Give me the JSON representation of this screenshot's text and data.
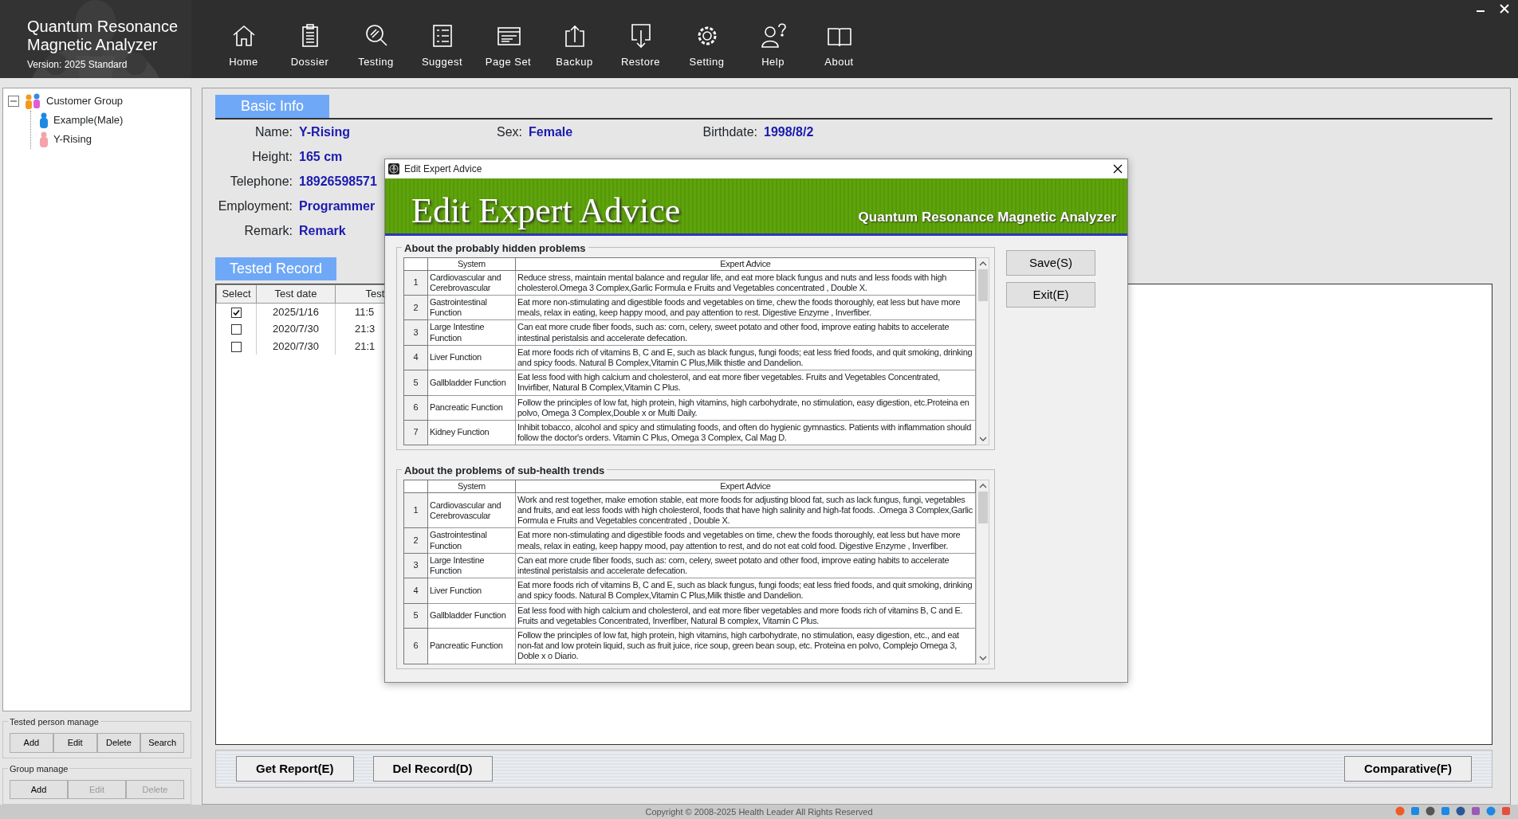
{
  "app": {
    "title_lines": [
      "Quantum Resonance",
      "Magnetic Analyzer"
    ],
    "version": "Version: 2025 Standard"
  },
  "toolbar": [
    {
      "label": "Home",
      "kind": "home"
    },
    {
      "label": "Dossier",
      "kind": "dossier"
    },
    {
      "label": "Testing",
      "kind": "testing"
    },
    {
      "label": "Suggest",
      "kind": "suggest"
    },
    {
      "label": "Page Set",
      "kind": "page"
    },
    {
      "label": "Backup",
      "kind": "backup"
    },
    {
      "label": "Restore",
      "kind": "restore"
    },
    {
      "label": "Setting",
      "kind": "setting"
    },
    {
      "label": "Help",
      "kind": "help"
    },
    {
      "label": "About",
      "kind": "about"
    }
  ],
  "tree": {
    "label": "Customer Group",
    "expanded": true,
    "children": [
      {
        "label": "Example(Male)",
        "color": "#1e88e5"
      },
      {
        "label": "Y-Rising",
        "color": "#f4a3aa"
      }
    ]
  },
  "tested_person_manage": {
    "title": "Tested person manage",
    "buttons": [
      {
        "label": "Add",
        "disabled": false
      },
      {
        "label": "Edit",
        "disabled": false
      },
      {
        "label": "Delete",
        "disabled": false
      },
      {
        "label": "Search",
        "disabled": false
      }
    ]
  },
  "group_manage": {
    "title": "Group manage",
    "buttons": [
      {
        "label": "Add",
        "disabled": false
      },
      {
        "label": "Edit",
        "disabled": true
      },
      {
        "label": "Delete",
        "disabled": true
      }
    ]
  },
  "basic_info": {
    "title": "Basic Info",
    "rows": [
      [
        {
          "label": "Name:",
          "value": "Y-Rising"
        },
        {
          "label": "Sex:",
          "value": "Female"
        },
        {
          "label": "Birthdate:",
          "value": "1998/8/2"
        }
      ],
      [
        {
          "label": "Height:",
          "value": "165 cm"
        }
      ],
      [
        {
          "label": "Telephone:",
          "value": "18926598571"
        }
      ],
      [
        {
          "label": "Employment:",
          "value": "Programmer"
        }
      ],
      [
        {
          "label": "Remark:",
          "value": "Remark"
        }
      ]
    ]
  },
  "tested_record": {
    "title": "Tested Record",
    "columns": [
      "Select",
      "Test date",
      "Test"
    ],
    "rows": [
      {
        "checked": true,
        "date": "2025/1/16",
        "time": "11:5"
      },
      {
        "checked": false,
        "date": "2020/7/30",
        "time": "21:3"
      },
      {
        "checked": false,
        "date": "2020/7/30",
        "time": "21:1"
      }
    ]
  },
  "left_buttons": [
    "Get Report(E)",
    "Del Record(D)"
  ],
  "right_buttons": [
    "Comparative(F)"
  ],
  "footer": "Copyright © 2008-2025 Health Leader All Rights Reserved",
  "dialog": {
    "title": "Edit Expert Advice",
    "banner_title": "Edit Expert Advice",
    "banner_subtitle": "Quantum Resonance Magnetic Analyzer",
    "buttons": [
      "Save(S)",
      "Exit(E)"
    ],
    "sections": [
      {
        "title": "About the probably hidden problems",
        "columns": [
          "System",
          "Expert Advice"
        ],
        "rows": [
          {
            "index": "1",
            "system": "Cardiovascular and Cerebrovascular",
            "advice": "Reduce stress, maintain mental balance and regular life, and eat more black fungus and nuts and less foods with high cholesterol.Omega 3 Complex,Garlic Formula e Fruits and Vegetables concentrated , Double X."
          },
          {
            "index": "2",
            "system": "Gastrointestinal Function",
            "advice": "Eat more non-stimulating and digestible foods and vegetables on time, chew the foods thoroughly, eat less but have more meals, relax in eating, keep happy mood, and pay attention to rest. Digestive Enzyme , Inverfiber."
          },
          {
            "index": "3",
            "system": "Large Intestine Function",
            "advice": "Can eat more crude fiber foods, such as: corn, celery, sweet potato and other food, improve eating habits to accelerate intestinal peristalsis and accelerate defecation."
          },
          {
            "index": "4",
            "system": "Liver Function",
            "advice": "Eat more foods rich of vitamins B, C and E, such as black fungus, fungi foods; eat less fried foods, and quit smoking, drinking and spicy foods. Natural B Complex,Vitamin C Plus,Milk thistle and Dandelion."
          },
          {
            "index": "5",
            "system": "Gallbladder Function",
            "advice": "Eat less food with high calcium and cholesterol, and eat more fiber vegetables. Fruits and Vegetables Concentrated, Invirfiber, Natural B Complex,Vitamin C Plus."
          },
          {
            "index": "6",
            "system": "Pancreatic Function",
            "advice": "Follow the principles of low fat, high protein, high vitamins, high carbohydrate, no stimulation, easy digestion, etc.Proteina en polvo, Omega 3 Complex,Double x or  Multi Daily."
          },
          {
            "index": "7",
            "system": "Kidney Function",
            "advice": "Inhibit tobacco, alcohol and spicy and stimulating foods, and often do hygienic gymnastics. Patients with inflammation should follow the doctor's orders. Vitamin C Plus, Omega 3 Complex, Cal Mag D."
          }
        ]
      },
      {
        "title": "About the problems of sub-health trends",
        "columns": [
          "System",
          "Expert Advice"
        ],
        "rows": [
          {
            "index": "1",
            "system": "Cardiovascular and Cerebrovascular",
            "advice": "Work and rest together, make emotion stable, eat more foods for adjusting blood fat, such as lack fungus, fungi, vegetables and fruits, and eat less foods with high cholesterol, foods that have high salinity and high-fat foods. .Omega 3 Complex,Garlic Formula e Fruits and Vegetables concentrated , Double X."
          },
          {
            "index": "2",
            "system": "Gastrointestinal Function",
            "advice": "Eat more non-stimulating and digestible foods and vegetables on time, chew the foods thoroughly, eat less but have more meals, relax in eating, keep happy mood, pay attention to rest, and do not eat cold food.  Digestive Enzyme , Inverfiber."
          },
          {
            "index": "3",
            "system": "Large Intestine Function",
            "advice": "Can eat more crude fiber foods, such as: corn, celery, sweet potato and other food, improve eating habits to accelerate intestinal peristalsis and accelerate defecation."
          },
          {
            "index": "4",
            "system": "Liver Function",
            "advice": "Eat more foods rich of vitamins B, C and E, such as black fungus, fungi foods; eat less fried foods, and quit smoking, drinking and spicy foods. Natural B Complex,Vitamin C Plus,Milk thistle and Dandelion."
          },
          {
            "index": "5",
            "system": "Gallbladder Function",
            "advice": "Eat less food with high calcium and cholesterol, and eat more fiber vegetables and more foods rich of vitamins B, C and E. Fruits and vegetables Concentrated, Inverfiber, Natural B complex, Vitamin C Plus."
          },
          {
            "index": "6",
            "system": "Pancreatic Function",
            "advice": "Follow the principles of low fat, high protein, high vitamins, high carbohydrate, no stimulation, easy digestion, etc., and eat non-fat and low protein liquid, such as fruit juice, rice soup, green bean soup, etc. Proteina en polvo, Complejo Omega 3, Doble x o Diario."
          }
        ]
      }
    ]
  }
}
